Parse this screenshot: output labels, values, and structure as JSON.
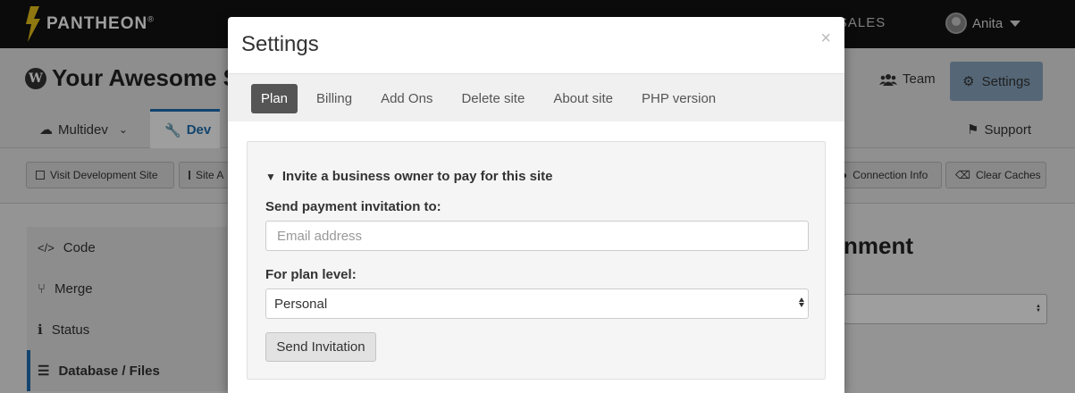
{
  "topbar": {
    "brand": "PANTHEON",
    "brand_mark": "®",
    "contact_sales": "ACT SALES",
    "user_name": "Anita"
  },
  "site": {
    "title": "Your Awesome S",
    "team_label": "Team",
    "settings_label": "Settings",
    "multidev_label": "Multidev",
    "dev_label": "Dev",
    "support_label": "Support"
  },
  "toolbar": {
    "visit_site": "Visit Development Site",
    "site_admin": "Site A",
    "connection_info": "Connection Info",
    "clear_caches": "Clear Caches"
  },
  "sidebar": {
    "items": [
      {
        "label": "Code"
      },
      {
        "label": "Merge"
      },
      {
        "label": "Status"
      },
      {
        "label": "Database / Files"
      }
    ]
  },
  "main": {
    "heading": "nment"
  },
  "modal": {
    "title": "Settings",
    "close": "×",
    "tabs": [
      {
        "label": "Plan",
        "active": true
      },
      {
        "label": "Billing"
      },
      {
        "label": "Add Ons"
      },
      {
        "label": "Delete site"
      },
      {
        "label": "About site"
      },
      {
        "label": "PHP version"
      }
    ],
    "invite": {
      "summary": "Invite a business owner to pay for this site",
      "send_to_label": "Send payment invitation to:",
      "email_placeholder": "Email address",
      "plan_label": "For plan level:",
      "plan_value": "Personal",
      "send_button": "Send Invitation"
    }
  },
  "colors": {
    "active_tab": "#555555",
    "accent_blue": "#1f6fb2",
    "settings_button": "#8aa6c1"
  }
}
